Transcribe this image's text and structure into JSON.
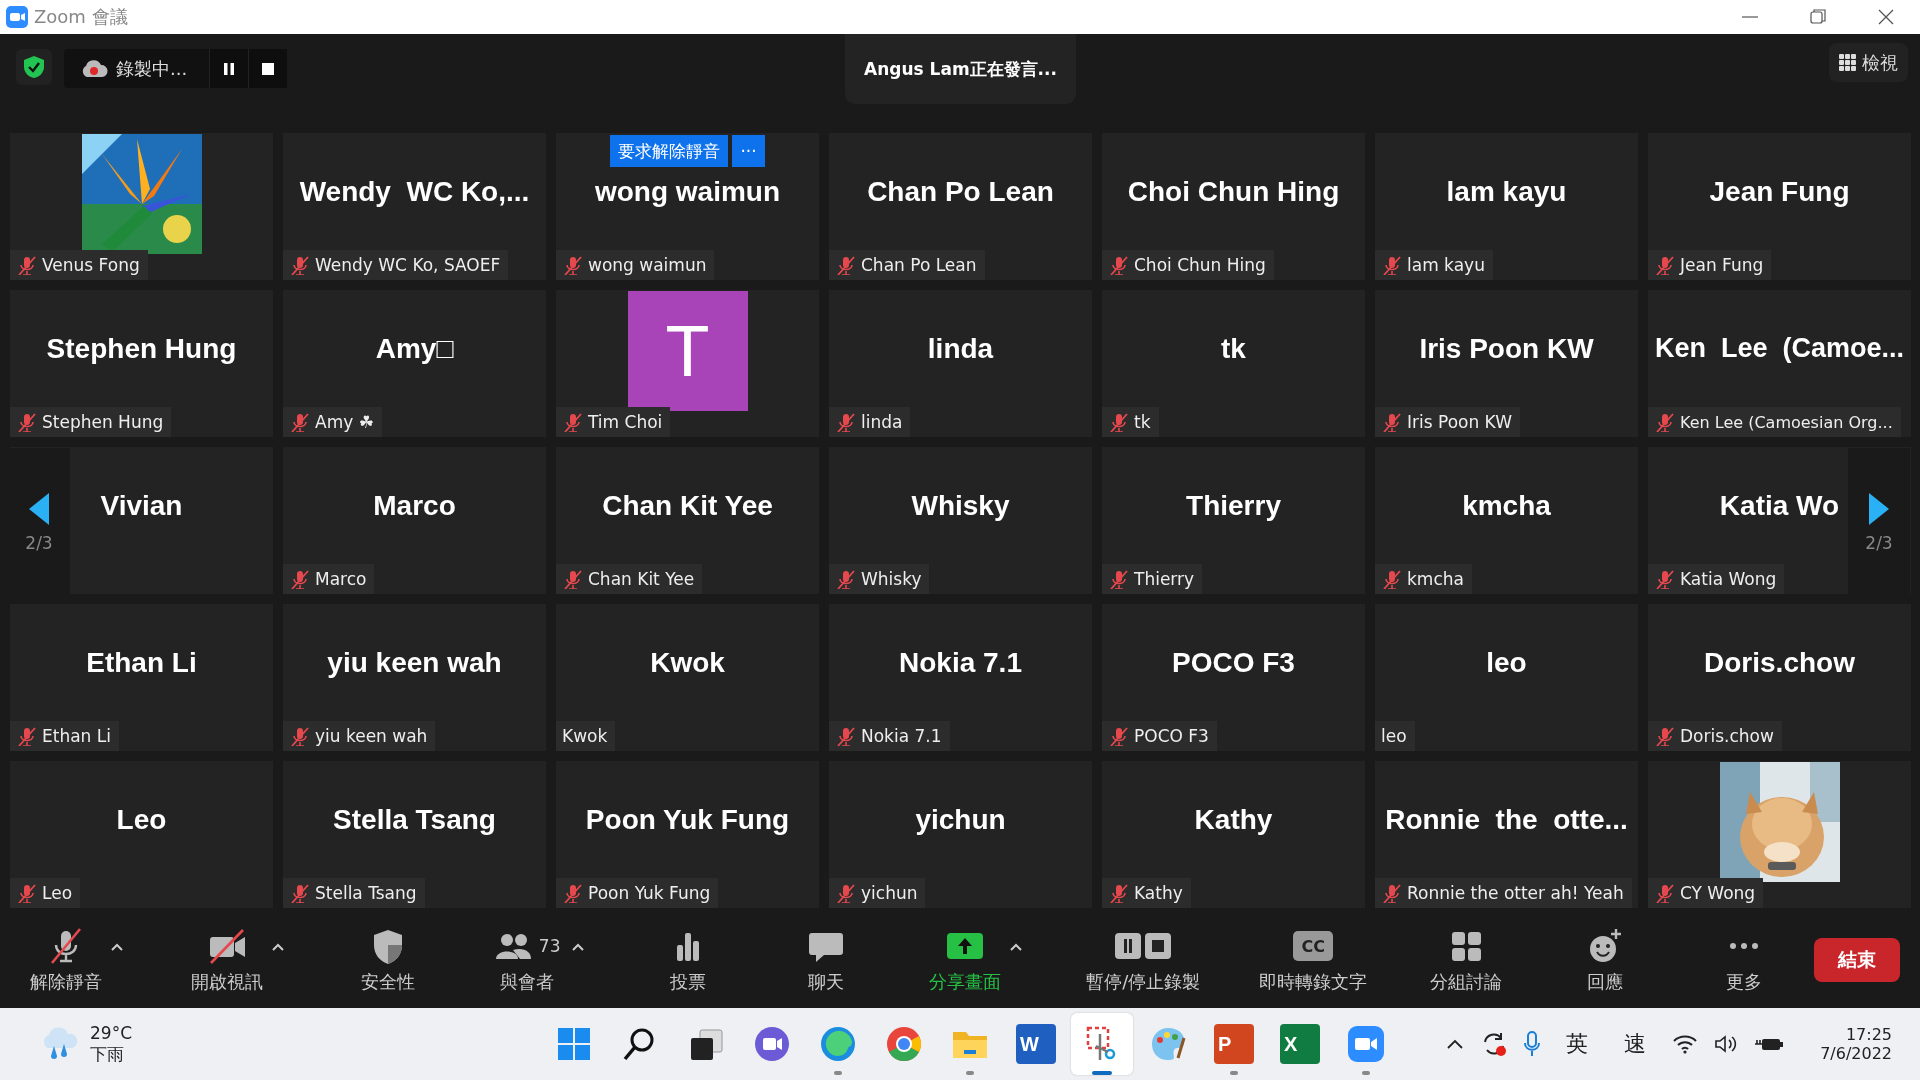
{
  "window": {
    "title": "Zoom 會議"
  },
  "top_bar": {
    "recording": {
      "label": "錄製中..."
    },
    "speaker_banner": "Angus Lam正在發言...",
    "view_button": "檢視"
  },
  "tiles": [
    {
      "kind": "picture",
      "label": "Venus Fong",
      "muted": true
    },
    {
      "kind": "name",
      "display": "Wendy  WC Ko,...",
      "label": "Wendy WC Ko, SAOEF",
      "muted": true
    },
    {
      "kind": "name",
      "display": "wong waimun",
      "label": "wong waimun",
      "muted": true,
      "actions": [
        "要求解除靜音",
        "···"
      ]
    },
    {
      "kind": "name",
      "display": "Chan Po Lean",
      "label": "Chan Po Lean",
      "muted": true
    },
    {
      "kind": "name",
      "display": "Choi Chun Hing",
      "label": "Choi Chun Hing",
      "muted": true
    },
    {
      "kind": "name",
      "display": "lam kayu",
      "label": "lam kayu",
      "muted": true
    },
    {
      "kind": "name",
      "display": "Jean Fung",
      "label": "Jean Fung",
      "muted": true
    },
    {
      "kind": "name",
      "display": "Stephen Hung",
      "label": "Stephen Hung",
      "muted": true
    },
    {
      "kind": "name",
      "display": "Amy□",
      "label": "Amy ☘",
      "muted": true
    },
    {
      "kind": "avatar",
      "display": "T",
      "color": "#a843b8",
      "label": "Tim Choi",
      "muted": true
    },
    {
      "kind": "name",
      "display": "linda",
      "label": "linda",
      "muted": true
    },
    {
      "kind": "name",
      "display": "tk",
      "label": "tk",
      "muted": true
    },
    {
      "kind": "name",
      "display": "Iris Poon KW",
      "label": "Iris Poon KW",
      "muted": true
    },
    {
      "kind": "name",
      "display": "Ken  Lee  (Camoe...",
      "label": "Ken Lee (Camoesian Org...",
      "muted": true
    },
    {
      "kind": "name",
      "display": "Vivian"
    },
    {
      "kind": "name",
      "display": "Marco",
      "label": "Marco",
      "muted": true
    },
    {
      "kind": "name",
      "display": "Chan Kit Yee",
      "label": "Chan Kit Yee",
      "muted": true
    },
    {
      "kind": "name",
      "display": "Whisky",
      "label": "Whisky",
      "muted": true
    },
    {
      "kind": "name",
      "display": "Thierry",
      "label": "Thierry",
      "muted": true
    },
    {
      "kind": "name",
      "display": "kmcha",
      "label": "kmcha",
      "muted": true
    },
    {
      "kind": "name",
      "display": "Katia Wo",
      "label": "Katia Wong",
      "muted": true
    },
    {
      "kind": "name",
      "display": "Ethan Li",
      "label": "Ethan Li",
      "muted": true
    },
    {
      "kind": "name",
      "display": "yiu keen wah",
      "label": "yiu keen wah",
      "muted": true
    },
    {
      "kind": "name",
      "display": "Kwok",
      "label": "Kwok",
      "muted": false
    },
    {
      "kind": "name",
      "display": "Nokia 7.1",
      "label": "Nokia 7.1",
      "muted": true
    },
    {
      "kind": "name",
      "display": "POCO F3",
      "label": "POCO F3",
      "muted": true
    },
    {
      "kind": "name",
      "display": "leo",
      "label": "leo",
      "muted": false
    },
    {
      "kind": "name",
      "display": "Doris.chow",
      "label": "Doris.chow",
      "muted": true
    },
    {
      "kind": "name",
      "display": "Leo",
      "label": "Leo",
      "muted": true
    },
    {
      "kind": "name",
      "display": "Stella Tsang",
      "label": "Stella Tsang",
      "muted": true
    },
    {
      "kind": "name",
      "display": "Poon Yuk Fung",
      "label": "Poon Yuk Fung",
      "muted": true
    },
    {
      "kind": "name",
      "display": "yichun",
      "label": "yichun",
      "muted": true
    },
    {
      "kind": "name",
      "display": "Kathy",
      "label": "Kathy",
      "muted": true
    },
    {
      "kind": "name",
      "display": "Ronnie  the  otte...",
      "label": "Ronnie the otter ah! Yeah",
      "muted": true
    },
    {
      "kind": "picture",
      "label": "CY Wong",
      "muted": true
    }
  ],
  "pager": {
    "previous": "2/3",
    "next": "2/3"
  },
  "toolbar": [
    {
      "kind": "mic",
      "label": "解除靜音",
      "caret": true,
      "accent": false
    },
    {
      "kind": "video",
      "label": "開啟視訊",
      "caret": true,
      "accent": false
    },
    {
      "kind": "security",
      "label": "安全性",
      "caret": false,
      "accent": false
    },
    {
      "kind": "participants",
      "label": "與會者",
      "count": "73",
      "caret": true,
      "accent": false
    },
    {
      "kind": "poll",
      "label": "投票",
      "caret": false,
      "accent": false
    },
    {
      "kind": "chat",
      "label": "聊天",
      "caret": false,
      "accent": false
    },
    {
      "kind": "share",
      "label": "分享畫面",
      "caret": true,
      "accent": true
    },
    {
      "kind": "record",
      "label": "暫停/停止錄製",
      "caret": false,
      "accent": false
    },
    {
      "kind": "captions",
      "glyph": "CC",
      "label": "即時轉錄文字",
      "caret": false,
      "accent": false
    },
    {
      "kind": "rooms",
      "label": "分組討論",
      "caret": false,
      "accent": false
    },
    {
      "kind": "reaction",
      "label": "回應",
      "caret": false,
      "accent": false
    },
    {
      "kind": "more",
      "label": "更多",
      "caret": false,
      "accent": false
    }
  ],
  "end_button": "結束",
  "taskbar": {
    "weather": {
      "temperature": "29°C",
      "condition": "下雨"
    },
    "apps": [
      {
        "kind": "start",
        "running": false,
        "selected": false
      },
      {
        "kind": "search",
        "running": false,
        "selected": false
      },
      {
        "kind": "taskview",
        "running": false,
        "selected": false
      },
      {
        "kind": "chat",
        "running": false,
        "selected": false
      },
      {
        "kind": "edge",
        "running": true,
        "selected": false
      },
      {
        "kind": "chrome",
        "running": false,
        "selected": false
      },
      {
        "kind": "folder",
        "running": true,
        "selected": false
      },
      {
        "kind": "word",
        "letter": "W",
        "running": false,
        "selected": false
      },
      {
        "kind": "snip",
        "running": true,
        "selected": true
      },
      {
        "kind": "paint",
        "running": false,
        "selected": false
      },
      {
        "kind": "ppt",
        "letter": "P",
        "running": true,
        "selected": false
      },
      {
        "kind": "excel",
        "letter": "X",
        "running": false,
        "selected": false
      },
      {
        "kind": "zoom",
        "running": true,
        "selected": false
      }
    ],
    "tray": {
      "input_language": "英",
      "input_mode": "速",
      "time": "17:25",
      "date": "7/6/2022"
    }
  }
}
